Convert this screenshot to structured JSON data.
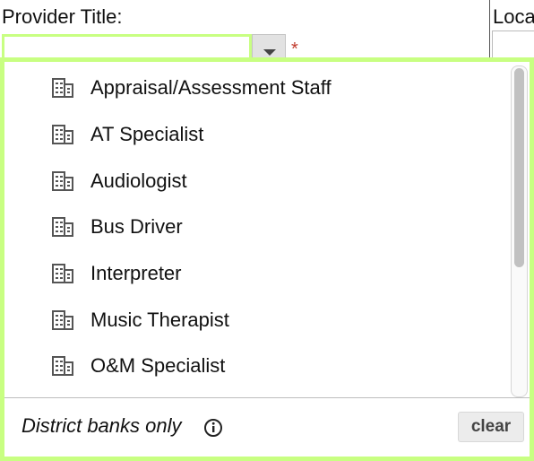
{
  "form": {
    "provider_title_label": "Provider Title:",
    "location_label": "Loca",
    "provider_title_value": "",
    "required_marker": "*"
  },
  "dropdown": {
    "items": [
      {
        "label": "Appraisal/Assessment Staff",
        "icon": "building-icon"
      },
      {
        "label": "AT Specialist",
        "icon": "building-icon"
      },
      {
        "label": "Audiologist",
        "icon": "building-icon"
      },
      {
        "label": "Bus Driver",
        "icon": "building-icon"
      },
      {
        "label": "Interpreter",
        "icon": "building-icon"
      },
      {
        "label": "Music Therapist",
        "icon": "building-icon"
      },
      {
        "label": "O&M Specialist",
        "icon": "building-icon"
      }
    ],
    "footer_text": "District banks only",
    "info_icon": "info-icon",
    "clear_label": "clear"
  },
  "colors": {
    "focus_border": "#c8ff82",
    "required": "#c0392b",
    "toggle_bg": "#e2e2e2"
  }
}
